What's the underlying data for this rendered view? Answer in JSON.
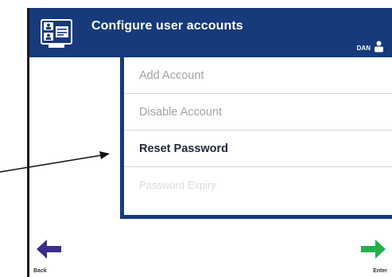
{
  "header": {
    "title": "Configure user accounts",
    "user": "DAN",
    "app_icon": "user-accounts-icon",
    "user_icon": "person-icon"
  },
  "menu": {
    "items": [
      {
        "label": "Add Account",
        "state": "disabled"
      },
      {
        "label": "Disable Account",
        "state": "disabled"
      },
      {
        "label": "Reset Password",
        "state": "active"
      },
      {
        "label": "Password Expiry",
        "state": "faded"
      }
    ]
  },
  "footer": {
    "back_label": "Back",
    "back_icon": "arrow-left-icon",
    "enter_label": "Enter",
    "enter_icon": "arrow-right-icon"
  },
  "colors": {
    "header_bg": "#163a7a",
    "back_arrow": "#3b2f8e",
    "enter_arrow": "#22b14c"
  }
}
